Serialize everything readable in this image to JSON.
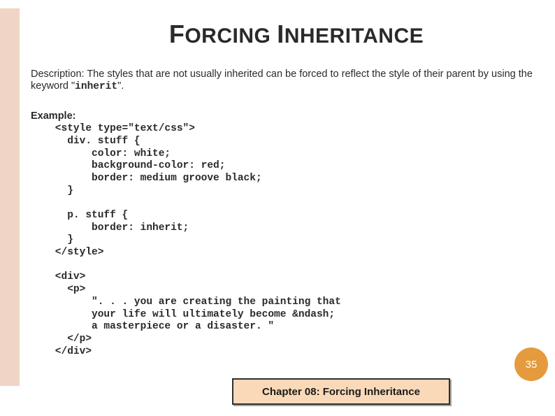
{
  "title": {
    "raw": "FORCING INHERITANCE"
  },
  "description": {
    "prefix": "Description: The styles that are not usually inherited can be forced to reflect the style of their parent by using the keyword \"",
    "keyword": "inherit",
    "suffix": "\"."
  },
  "example": {
    "label": "Example:",
    "code": "    <style type=\"text/css\">\n      div. stuff {\n          color: white;\n          background-color: red;\n          border: medium groove black;\n      }\n\n      p. stuff {\n          border: inherit;\n      }\n    </style>\n\n    <div>\n      <p>\n          \". . . you are creating the painting that\n          your life will ultimately become &ndash;\n          a masterpiece or a disaster. \"\n      </p>\n    </div>"
  },
  "chapter": "Chapter  08: Forcing Inheritance",
  "page_number": "35"
}
